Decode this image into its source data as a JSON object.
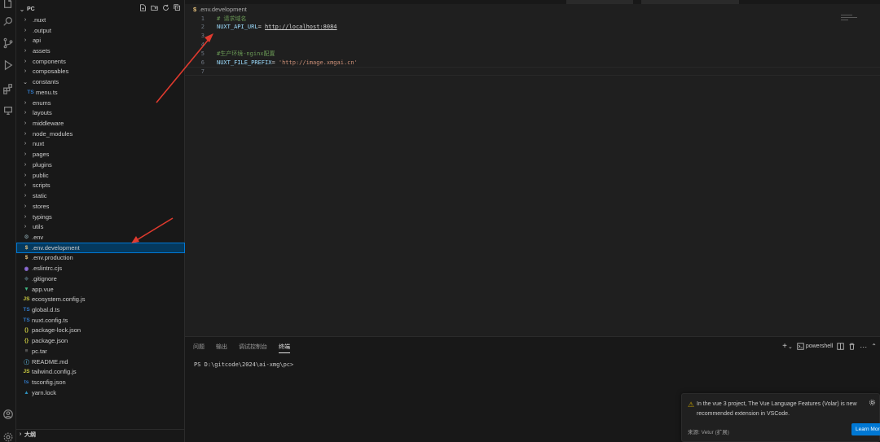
{
  "explorer": {
    "folder_name": "PC",
    "items": [
      {
        "label": ".nuxt",
        "kind": "folder",
        "expanded": false
      },
      {
        "label": ".output",
        "kind": "folder",
        "expanded": false
      },
      {
        "label": "api",
        "kind": "folder",
        "expanded": false
      },
      {
        "label": "assets",
        "kind": "folder",
        "expanded": false
      },
      {
        "label": "components",
        "kind": "folder",
        "expanded": false
      },
      {
        "label": "composables",
        "kind": "folder",
        "expanded": false
      },
      {
        "label": "constants",
        "kind": "folder",
        "expanded": true
      },
      {
        "label": "menu.ts",
        "kind": "file",
        "icon": "TS",
        "icon_color": "#3178c6",
        "nested": true
      },
      {
        "label": "enums",
        "kind": "folder",
        "expanded": false
      },
      {
        "label": "layouts",
        "kind": "folder",
        "expanded": false
      },
      {
        "label": "middleware",
        "kind": "folder",
        "expanded": false
      },
      {
        "label": "node_modules",
        "kind": "folder",
        "expanded": false
      },
      {
        "label": "nuxt",
        "kind": "folder",
        "expanded": false
      },
      {
        "label": "pages",
        "kind": "folder",
        "expanded": false
      },
      {
        "label": "plugins",
        "kind": "folder",
        "expanded": false
      },
      {
        "label": "public",
        "kind": "folder",
        "expanded": false
      },
      {
        "label": "scripts",
        "kind": "folder",
        "expanded": false
      },
      {
        "label": "static",
        "kind": "folder",
        "expanded": false
      },
      {
        "label": "stores",
        "kind": "folder",
        "expanded": false
      },
      {
        "label": "typings",
        "kind": "folder",
        "expanded": false
      },
      {
        "label": "utils",
        "kind": "folder",
        "expanded": false
      },
      {
        "label": ".env",
        "kind": "file",
        "icon": "⚙",
        "icon_color": "#6d8086"
      },
      {
        "label": ".env.development",
        "kind": "file",
        "icon": "$",
        "icon_color": "#e5c07b",
        "selected": true
      },
      {
        "label": ".env.production",
        "kind": "file",
        "icon": "$",
        "icon_color": "#e5c07b"
      },
      {
        "label": ".eslintrc.cjs",
        "kind": "file",
        "icon": "◉",
        "icon_color": "#8d6cd6"
      },
      {
        "label": ".gitignore",
        "kind": "file",
        "icon": "◆",
        "icon_color": "#41535b"
      },
      {
        "label": "app.vue",
        "kind": "file",
        "icon": "▼",
        "icon_color": "#41b883"
      },
      {
        "label": "ecosystem.config.js",
        "kind": "file",
        "icon": "JS",
        "icon_color": "#cbcb41"
      },
      {
        "label": "global.d.ts",
        "kind": "file",
        "icon": "TS",
        "icon_color": "#3178c6"
      },
      {
        "label": "nuxt.config.ts",
        "kind": "file",
        "icon": "TS",
        "icon_color": "#3178c6"
      },
      {
        "label": "package-lock.json",
        "kind": "file",
        "icon": "{}",
        "icon_color": "#cbcb41"
      },
      {
        "label": "package.json",
        "kind": "file",
        "icon": "{}",
        "icon_color": "#cbcb41"
      },
      {
        "label": "pc.tar",
        "kind": "file",
        "icon": "≡",
        "icon_color": "#8e8e8e"
      },
      {
        "label": "README.md",
        "kind": "file",
        "icon": "ⓘ",
        "icon_color": "#519aba"
      },
      {
        "label": "tailwind.config.js",
        "kind": "file",
        "icon": "JS",
        "icon_color": "#cbcb41"
      },
      {
        "label": "tsconfig.json",
        "kind": "file",
        "icon": "ts",
        "icon_color": "#3178c6"
      },
      {
        "label": "yarn.lock",
        "kind": "file",
        "icon": "▲",
        "icon_color": "#2c8ebb"
      }
    ],
    "outline_label": "大纲"
  },
  "editor": {
    "breadcrumb_file": ".env.development",
    "breadcrumb_icon": "$",
    "lines": [
      {
        "n": "1",
        "comment": "# 请求域名"
      },
      {
        "n": "2",
        "key": "NUXT_API_URL",
        "eq": "= ",
        "url": "http://localhost:8084"
      },
      {
        "n": "3"
      },
      {
        "n": "4"
      },
      {
        "n": "5",
        "comment": "#生产环境-nginx配置"
      },
      {
        "n": "6",
        "key": "NUXT_FILE_PREFIX",
        "eq": "= ",
        "str": "'http://image.xmgai.cn'"
      },
      {
        "n": "7"
      }
    ]
  },
  "panel": {
    "tabs": [
      "问题",
      "输出",
      "调试控制台",
      "终端"
    ],
    "active_tab": "终端",
    "shell_label": "powershell",
    "prompt": "PS D:\\gitcode\\2024\\ai-xmg\\pc>"
  },
  "notification": {
    "message": "In the vue 3 project, The Vue Language Features (Volar) is new recommended extension in VSCode.",
    "source": "来源: Vetur (扩展)",
    "action": "Learn More"
  },
  "colors": {
    "accent": "#0078d4",
    "annotation_arrow": "#e03a2e"
  }
}
